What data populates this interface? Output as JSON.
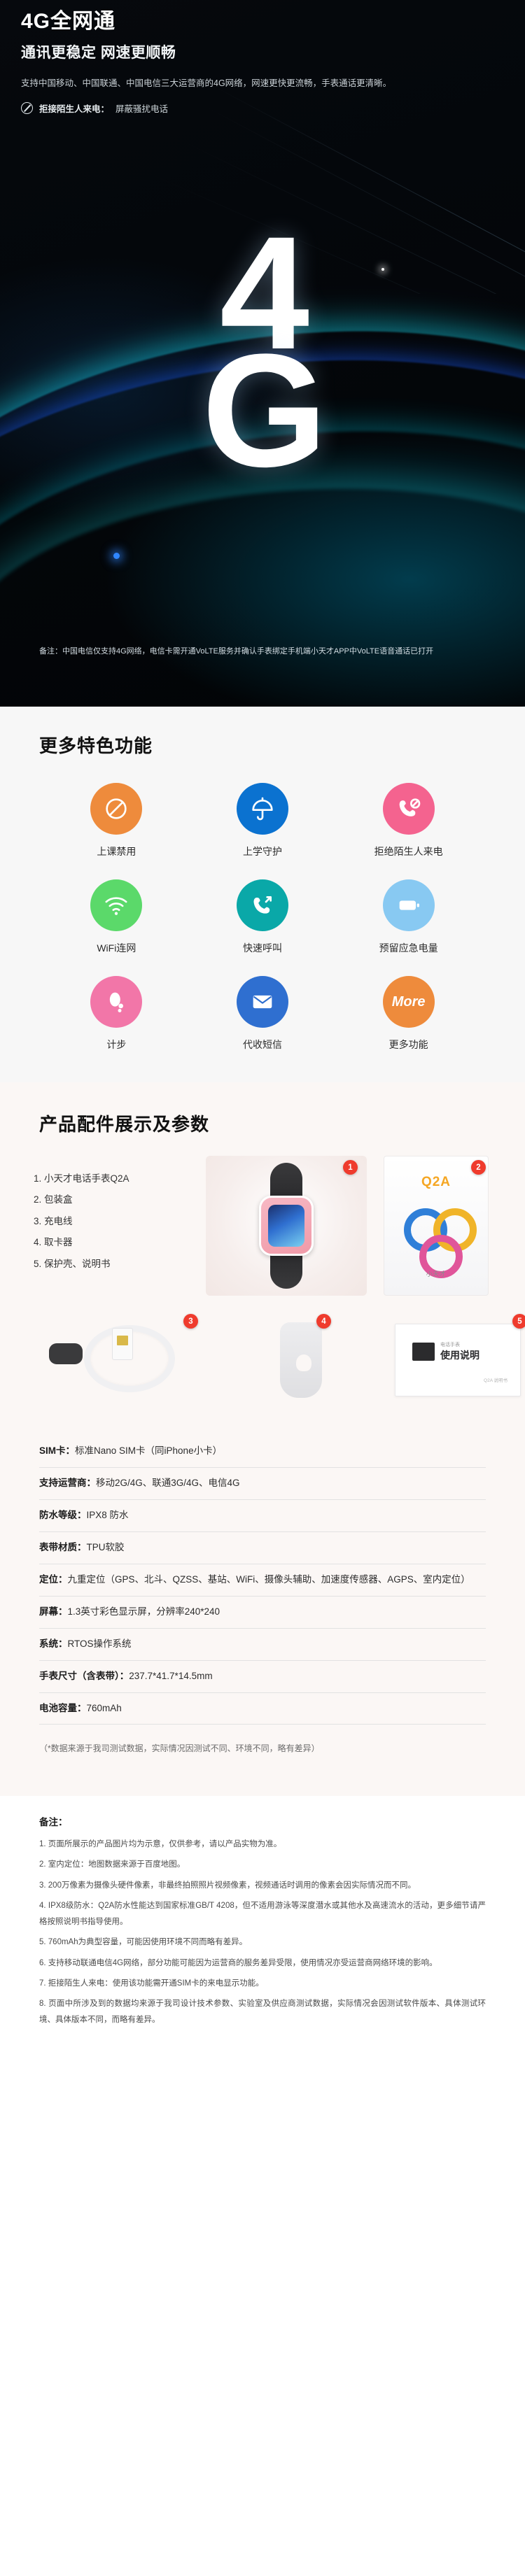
{
  "hero": {
    "title": "4G全网通",
    "subtitle": "通讯更稳定 网速更顺畅",
    "description": "支持中国移动、中国联通、中国电信三大运营商的4G网络，网速更快更流畅，手表通话更清晰。",
    "badge_main": "拒接陌生人来电：",
    "badge_secondary": "屏蔽骚扰电话",
    "big_char_1": "4",
    "big_char_2": "G",
    "note": "备注：中国电信仅支持4G网络，电信卡需开通VoLTE服务并确认手表绑定手机端小天才APP中VoLTE语音通话已打开",
    "colors": {
      "cyan": "#18e8ff",
      "blue": "#1a5cff",
      "background": "#000000"
    }
  },
  "features": {
    "title": "更多特色功能",
    "items": [
      {
        "label": "上课禁用",
        "icon": "no-entry-icon",
        "color": "#ee8b3c"
      },
      {
        "label": "上学守护",
        "icon": "umbrella-icon",
        "color": "#0b72d0"
      },
      {
        "label": "拒绝陌生人来电",
        "icon": "call-blocked-icon",
        "color": "#f4638f"
      },
      {
        "label": "WiFi连网",
        "icon": "wifi-icon",
        "color": "#5bd96a"
      },
      {
        "label": "快速呼叫",
        "icon": "quick-call-icon",
        "color": "#0aa8a8"
      },
      {
        "label": "预留应急电量",
        "icon": "battery-icon",
        "color": "#88c9f2"
      },
      {
        "label": "计步",
        "icon": "footstep-icon",
        "color": "#f276a8"
      },
      {
        "label": "代收短信",
        "icon": "sms-envelope-icon",
        "color": "#2f6fd0"
      },
      {
        "label": "更多功能",
        "icon": "more-icon",
        "color": "#ee8b3c",
        "badge_text": "More"
      }
    ]
  },
  "accessories": {
    "title": "产品配件展示及参数",
    "list": [
      "1. 小天才电话手表Q2A",
      "2. 包装盒",
      "3. 充电线",
      "4. 取卡器",
      "5. 保护壳、说明书"
    ],
    "badges": [
      "1",
      "2",
      "3",
      "4",
      "5"
    ],
    "box_brand": "Q2A",
    "box_sub": "小天才",
    "manual_brand": "小天才",
    "manual_sub": "电话手表",
    "manual_title": "使用说明",
    "manual_code": "Q2A 说明书"
  },
  "specs": {
    "rows": [
      {
        "key": "SIM卡：",
        "value": "标准Nano SIM卡（同iPhone小卡）"
      },
      {
        "key": "支持运营商：",
        "value": "移动2G/4G、联通3G/4G、电信4G"
      },
      {
        "key": "防水等级：",
        "value": "IPX8 防水"
      },
      {
        "key": "表带材质：",
        "value": "TPU软胶"
      },
      {
        "key": "定位：",
        "value": "九重定位（GPS、北斗、QZSS、基站、WiFi、摄像头辅助、加速度传感器、AGPS、室内定位）"
      },
      {
        "key": "屏幕：",
        "value": "1.3英寸彩色显示屏，分辨率240*240"
      },
      {
        "key": "系统：",
        "value": "RTOS操作系统"
      },
      {
        "key": "手表尺寸（含表带）：",
        "value": "237.7*41.7*14.5mm"
      },
      {
        "key": "电池容量：",
        "value": "760mAh"
      }
    ],
    "footnote": "（*数据来源于我司测试数据，实际情况因测试不同、环境不同，略有差异）"
  },
  "remarks": {
    "title": "备注：",
    "items": [
      "1. 页面所展示的产品图片均为示意，仅供参考，请以产品实物为准。",
      "2. 室内定位：地图数据来源于百度地图。",
      "3. 200万像素为摄像头硬件像素，非最终拍照照片视频像素，视频通话时调用的像素会因实际情况而不同。",
      "4. IPX8级防水：Q2A防水性能达到国家标准GB/T 4208，但不适用游泳等深度潜水或其他水及高速流水的活动，更多细节请严格按照说明书指导使用。",
      "5. 760mAh为典型容量，可能因使用环境不同而略有差异。",
      "6. 支持移动联通电信4G网络，部分功能可能因为运营商的服务差异受限，使用情况亦受运营商网络环境的影响。",
      "7. 拒接陌生人来电：使用该功能需开通SIM卡的来电显示功能。",
      "8. 页面中所涉及到的数据均来源于我司设计技术参数、实验室及供应商测试数据，实际情况会因测试软件版本、具体测试环境、具体版本不同，而略有差异。"
    ]
  }
}
